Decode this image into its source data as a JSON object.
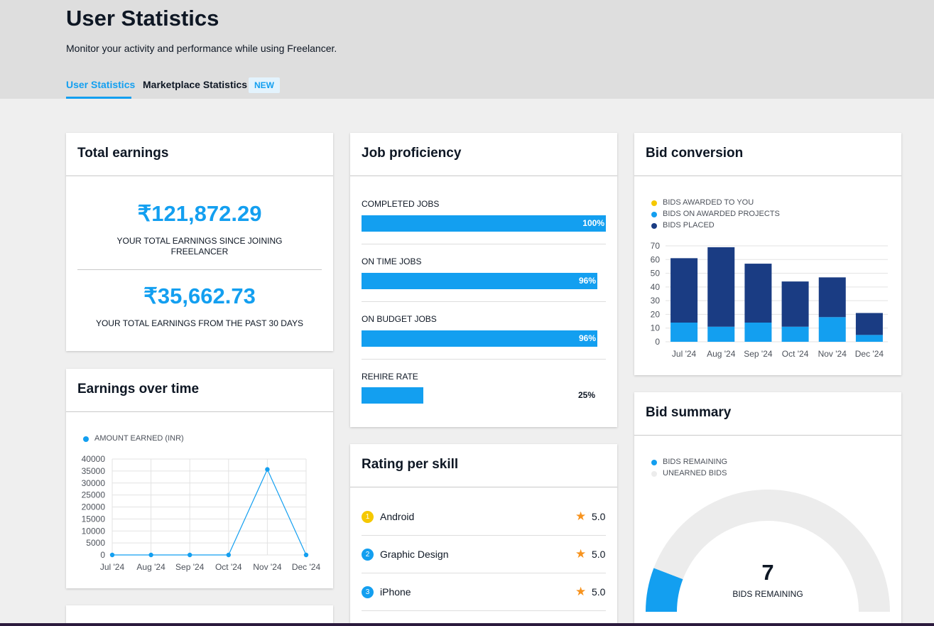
{
  "header": {
    "title": "User Statistics",
    "subtitle": "Monitor your activity and performance while using Freelancer.",
    "tabs": [
      {
        "label": "User Statistics",
        "active": true
      },
      {
        "label": "Marketplace Statistics",
        "active": false
      }
    ],
    "new_badge": "NEW"
  },
  "colors": {
    "accent": "#139ff0",
    "dark_blue": "#1a3c83",
    "yellow": "#f5c800",
    "light_gray": "#ececec",
    "star": "#f7931e"
  },
  "total_earnings": {
    "title": "Total earnings",
    "total_amount": "₹121,872.29",
    "total_caption": "YOUR TOTAL EARNINGS SINCE JOINING FREELANCER",
    "recent_amount": "₹35,662.73",
    "recent_caption": "YOUR TOTAL EARNINGS FROM THE PAST 30 DAYS"
  },
  "job_proficiency": {
    "title": "Job proficiency",
    "items": [
      {
        "label": "COMPLETED JOBS",
        "value": 100,
        "text": "100%"
      },
      {
        "label": "ON TIME JOBS",
        "value": 96,
        "text": "96%"
      },
      {
        "label": "ON BUDGET JOBS",
        "value": 96,
        "text": "96%"
      },
      {
        "label": "REHIRE RATE",
        "value": 25,
        "text": "25%"
      }
    ]
  },
  "earnings_over_time": {
    "title": "Earnings over time"
  },
  "rating_per_skill": {
    "title": "Rating per skill",
    "skills": [
      {
        "rank": "1",
        "name": "Android",
        "rating": "5.0",
        "badge_color": "#f5c800"
      },
      {
        "rank": "2",
        "name": "Graphic Design",
        "rating": "5.0",
        "badge_color": "#139ff0"
      },
      {
        "rank": "3",
        "name": "iPhone",
        "rating": "5.0",
        "badge_color": "#139ff0"
      }
    ]
  },
  "bid_conversion": {
    "title": "Bid conversion"
  },
  "bid_summary": {
    "title": "Bid summary",
    "value": "7",
    "caption": "BIDS REMAINING"
  },
  "chart_data": [
    {
      "type": "line",
      "x": [
        "Jul '24",
        "Aug '24",
        "Sep '24",
        "Oct '24",
        "Nov '24",
        "Dec '24"
      ],
      "series": [
        {
          "name": "AMOUNT EARNED (INR)",
          "values": [
            0,
            0,
            0,
            0,
            35663,
            0
          ],
          "color": "#139ff0"
        }
      ],
      "ylim": [
        0,
        40000
      ],
      "yticks": [
        0,
        5000,
        10000,
        15000,
        20000,
        25000,
        30000,
        35000,
        40000
      ],
      "grid": true,
      "legend": "top-left"
    },
    {
      "type": "bar",
      "stacked": true,
      "categories": [
        "Jul '24",
        "Aug '24",
        "Sep '24",
        "Oct '24",
        "Nov '24",
        "Dec '24"
      ],
      "series": [
        {
          "name": "BIDS AWARDED TO YOU",
          "values": [
            0,
            0,
            0,
            0,
            0,
            0
          ],
          "color": "#f5c800"
        },
        {
          "name": "BIDS ON AWARDED PROJECTS",
          "values": [
            14,
            11,
            14,
            11,
            18,
            5
          ],
          "color": "#139ff0"
        },
        {
          "name": "BIDS PLACED",
          "values": [
            47,
            58,
            43,
            33,
            29,
            16
          ],
          "color": "#1a3c83"
        }
      ],
      "ylim": [
        0,
        70
      ],
      "yticks": [
        0,
        10,
        20,
        30,
        40,
        50,
        60,
        70
      ],
      "grid": true,
      "legend": "top-left"
    },
    {
      "type": "pie",
      "variant": "gauge",
      "series": [
        {
          "name": "BIDS REMAINING",
          "value": 7,
          "color": "#139ff0"
        },
        {
          "name": "UNEARNED BIDS",
          "value": 53,
          "color": "#ececec"
        }
      ],
      "legend": "top-left"
    }
  ]
}
